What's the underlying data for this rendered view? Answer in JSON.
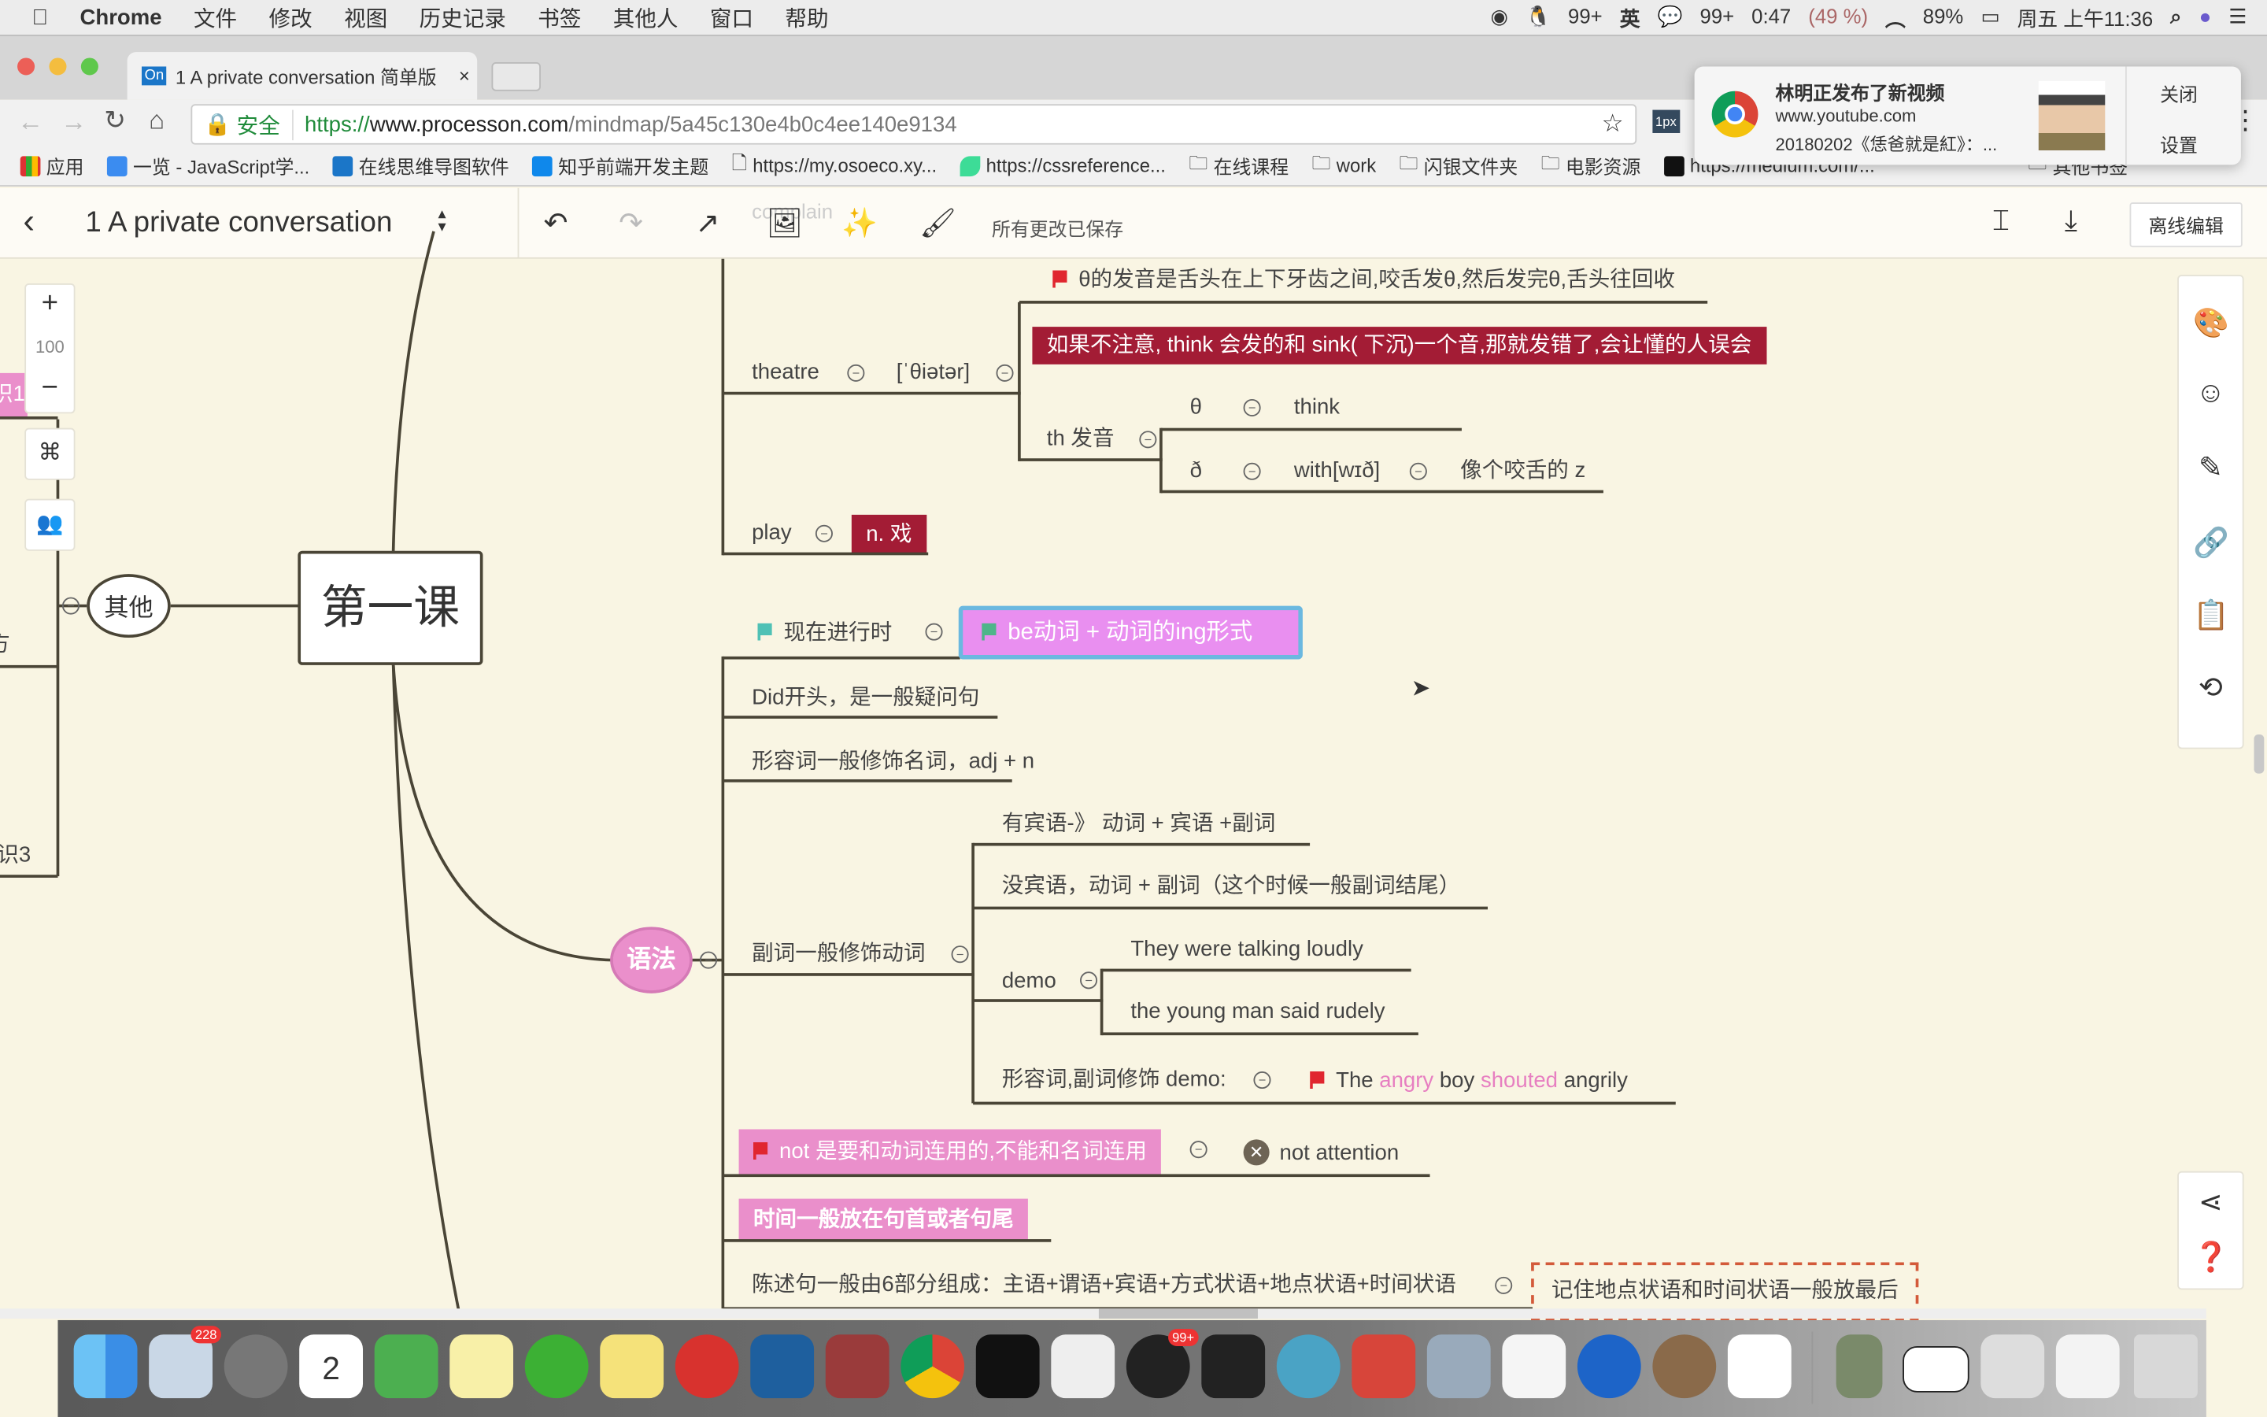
{
  "menubar": {
    "app": "Chrome",
    "items": [
      "文件",
      "修改",
      "视图",
      "历史记录",
      "书签",
      "其他人",
      "窗口",
      "帮助"
    ],
    "status": [
      "99+",
      "英",
      "99+",
      "0:47",
      "(49 %)",
      "89%",
      "周五 上午11:36"
    ]
  },
  "browser": {
    "tab_title": "1 A private conversation 简单版",
    "tab_favicon": "On",
    "secure_label": "安全",
    "url_scheme": "https://",
    "url_host": "www.processon.com",
    "url_path": "/mindmap/5a45c130e4b0c4ee140e9134",
    "ext_label": "1px",
    "bookmarks": [
      "应用",
      "一览 - JavaScript学...",
      "在线思维导图软件",
      "知乎前端开发主题",
      "https://my.osoeco.xy...",
      "https://cssreference...",
      "在线课程",
      "work",
      "闪银文件夹",
      "电影资源",
      "https://medium.com/...",
      "其他书签"
    ]
  },
  "notification": {
    "title": "林明正发布了新视频",
    "site": "www.youtube.com",
    "body": "20180202《恁爸就是紅》：...",
    "close_label": "关闭",
    "settings_label": "设置"
  },
  "toolbar": {
    "doc_title": "1 A private conversation",
    "save_status": "所有更改已保存",
    "offline_edit": "离线编辑",
    "ghost_text": "complain"
  },
  "zoom": {
    "level": "100"
  },
  "mindmap": {
    "root": "第一课",
    "other": "其他",
    "grammar": "语法",
    "left_partial": [
      "识1",
      "方",
      "识3"
    ],
    "theatre": "theatre",
    "theatre_ipa": "[ˈθiətər]",
    "theta_note": "θ的发音是舌头在上下牙齿之间,咬舌发θ,然后发完θ,舌头往回收",
    "warning": "如果不注意, think 会发的和 sink( 下沉)一个音,那就发错了,会让懂的人误会",
    "th_sound": "th 发音",
    "theta": "θ",
    "think": "think",
    "eth": "ð",
    "with": "with[wɪð]",
    "eth_note": "像个咬舌的 z",
    "play": "play",
    "play_meaning": "n. 戏",
    "present_continuous": "现在进行时",
    "present_continuous_rule": "be动词 + 动词的ing形式",
    "did": "Did开头，是一般疑问句",
    "adj": "形容词一般修饰名词，adj + n",
    "adv": "副词一般修饰动词",
    "adv_obj": "有宾语-》 动词 + 宾语 +副词",
    "adv_noobj": "没宾语，动词 + 副词（这个时候一般副词结尾）",
    "demo": "demo",
    "demo1": "They were talking loudly",
    "demo2": "the young man said rudely",
    "adjadv": "形容词,副词修饰 demo:",
    "ex_the": "The ",
    "ex_angry": "angry",
    "ex_boy": " boy ",
    "ex_shouted": "shouted",
    "ex_angrily": " angrily",
    "not_rule": "not 是要和动词连用的,不能和名词连用",
    "not_attention": "not attention",
    "time_rule": "时间一般放在句首或者句尾",
    "sentence": "陈述句一般由6部分组成：主语+谓语+宾语+方式状语+地点状语+时间状语",
    "sentence_note": "记住地点状语和时间状语一般放最后"
  },
  "colors": {
    "canvas": "#f9f5e3",
    "red_node": "#a31c35",
    "pink_node": "#ea8fcb",
    "selected_node": "#e98ff0",
    "flag_red": "#e0262f",
    "flag_teal": "#4fc1b5",
    "highlight_pink": "#e77fc1"
  },
  "dock": {
    "badges": [
      "228",
      "2",
      "99+"
    ]
  }
}
